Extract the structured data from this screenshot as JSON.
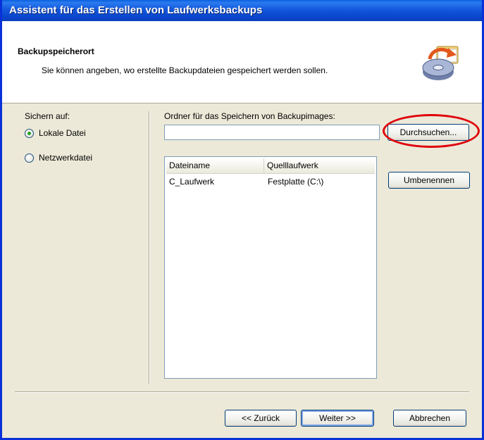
{
  "window": {
    "title": "Assistent für das Erstellen von Laufwerksbackups"
  },
  "header": {
    "title": "Backupspeicherort",
    "subtitle": "Sie können angeben, wo erstellte Backupdateien gespeichert werden sollen.",
    "icon": "backup-drive-icon"
  },
  "left": {
    "save_to_label": "Sichern auf:",
    "options": [
      {
        "label": "Lokale Datei",
        "selected": true
      },
      {
        "label": "Netzwerkdatei",
        "selected": false
      }
    ]
  },
  "right": {
    "folder_label": "Ordner für das Speichern von Backupimages:",
    "folder_value": "",
    "browse_button": "Durchsuchen...",
    "rename_button": "Umbenennen",
    "table": {
      "columns": [
        "Dateiname",
        "Quelllaufwerk"
      ],
      "rows": [
        [
          "C_Laufwerk",
          "Festplatte (C:\\)"
        ]
      ]
    }
  },
  "footer": {
    "back_button": "<< Zurück",
    "next_button": "Weiter >>",
    "cancel_button": "Abbrechen"
  },
  "colors": {
    "titlebar": "#0a3fbf",
    "highlight": "#e0000b",
    "dialog": "#ece9d8"
  }
}
